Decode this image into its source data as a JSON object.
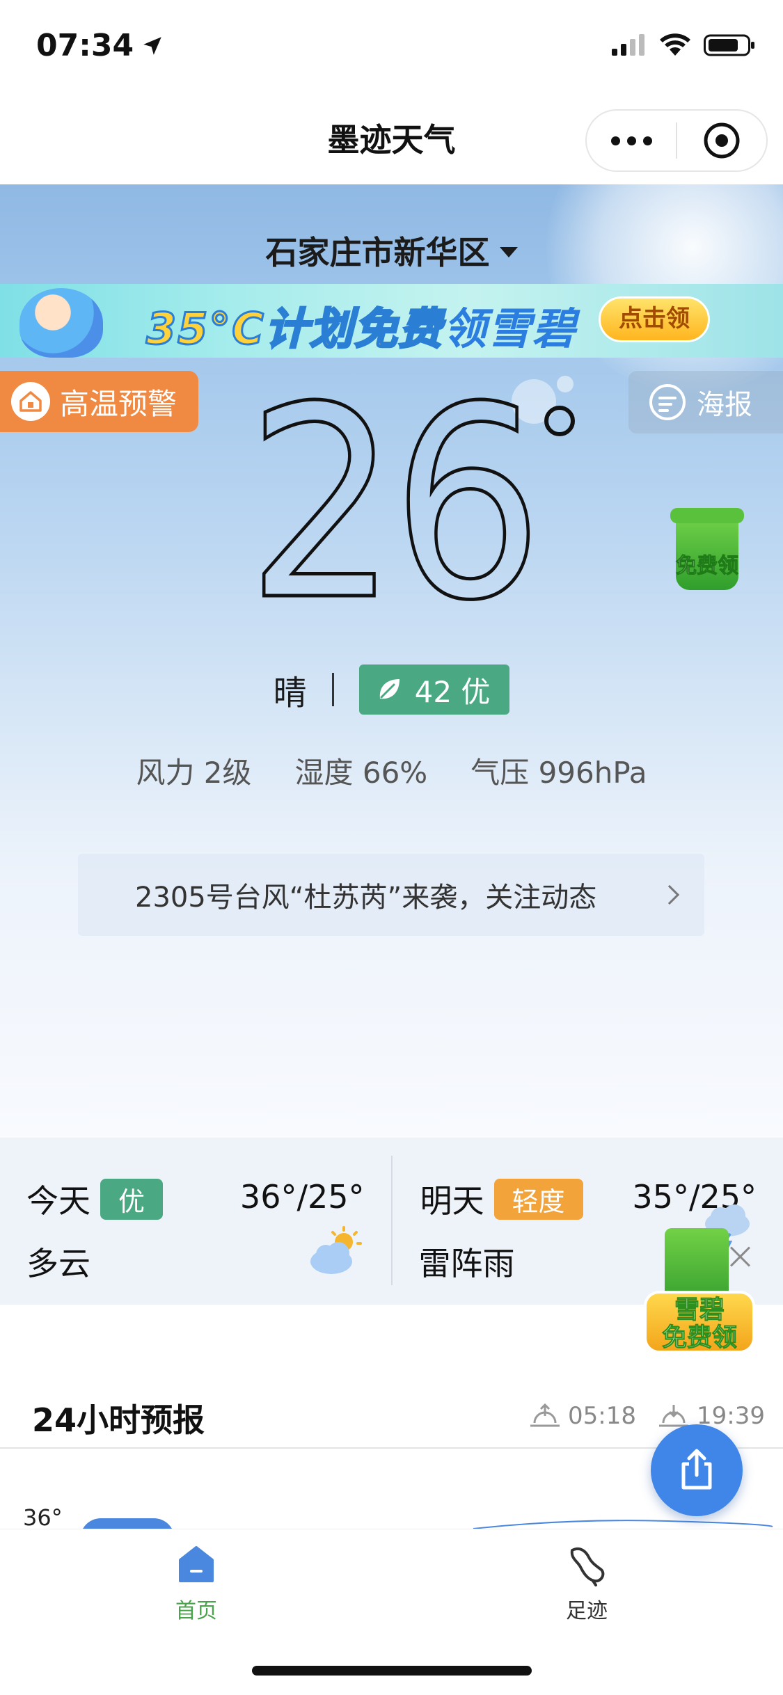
{
  "status_bar": {
    "time": "07:34"
  },
  "nav": {
    "title": "墨迹天气"
  },
  "location": {
    "name": "石家庄市新华区"
  },
  "promo_banner": {
    "headline_a": "35°C计划",
    "headline_b": "免费",
    "headline_c": "领雪碧",
    "button_label": "点击领"
  },
  "alert": {
    "label": "高温预警"
  },
  "poster": {
    "label": "海报"
  },
  "current": {
    "temperature": "26",
    "condition": "晴",
    "aqi_value": "42 优",
    "wind": "风力 2级",
    "humidity": "湿度 66%",
    "pressure": "气压 996hPa"
  },
  "cup_badge": {
    "label": "免费领"
  },
  "news": {
    "text": "2305号台风“杜苏芮”来袭，关注动态"
  },
  "forecast": [
    {
      "day": "今天",
      "aqi": "优",
      "range": "36°/25°",
      "condition": "多云",
      "icon": "partly-cloudy-icon"
    },
    {
      "day": "明天",
      "aqi": "轻度",
      "range": "35°/25°",
      "condition": "雷阵雨",
      "icon": "thunderstorm-icon"
    }
  ],
  "float_promo": {
    "label_top": "雪碧",
    "label_bottom": "免费领"
  },
  "hourly": {
    "title": "24小时预报",
    "sunrise": "05:18",
    "sunset": "19:39",
    "top_temp": "36°"
  },
  "tabs": [
    {
      "label": "首页",
      "icon": "home-icon"
    },
    {
      "label": "足迹",
      "icon": "footprint-icon"
    }
  ],
  "colors": {
    "accent_green": "#48a34a",
    "aqi_good": "#4aa882",
    "aqi_light": "#f2a33a",
    "alert_orange": "#f08a43",
    "share_blue": "#3f86e8"
  }
}
